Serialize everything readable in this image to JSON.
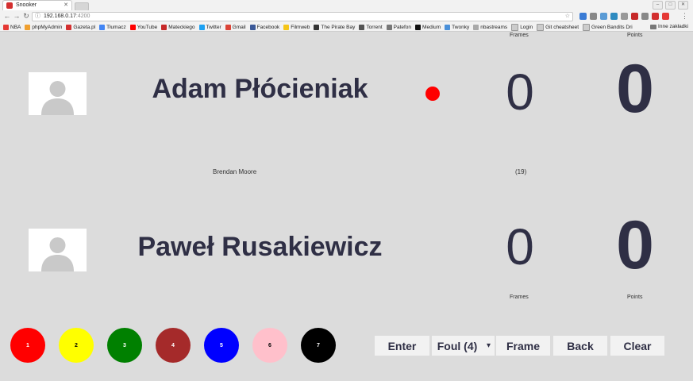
{
  "browser": {
    "tab_title": "Snooker",
    "url_host": "192.168.0.17",
    "url_port": ":4200",
    "bookmarks": [
      "NBA",
      "phpMyAdmin",
      "Gazeta.pl",
      "Tłumacz",
      "YouTube",
      "Mateckiego",
      "Twitter",
      "Gmail",
      "Facebook",
      "Filmweb",
      "The Pirate Bay",
      "Torrent",
      "Patefon",
      "Medium",
      "Twonky",
      "nbastreams",
      "Login",
      "Git cheatsheet",
      "Green Bandits Dri"
    ],
    "other_bookmarks": "Inne zakładki"
  },
  "labels": {
    "frames": "Frames",
    "points": "Points"
  },
  "player1": {
    "name": "Adam Płócieniak",
    "frames": "0",
    "points": "0",
    "at_table": true
  },
  "player2": {
    "name": "Paweł Rusakiewicz",
    "frames": "0",
    "points": "0"
  },
  "referee": "Brendan Moore",
  "break": "(19)",
  "balls": [
    {
      "label": "1",
      "color": "#ff0000",
      "text_color": "#ffffff"
    },
    {
      "label": "2",
      "color": "#ffff00",
      "text_color": "#000000"
    },
    {
      "label": "3",
      "color": "#008000",
      "text_color": "#ffffff"
    },
    {
      "label": "4",
      "color": "#a52a2a",
      "text_color": "#ffffff"
    },
    {
      "label": "5",
      "color": "#0000ff",
      "text_color": "#ffffff"
    },
    {
      "label": "6",
      "color": "#ffc0cb",
      "text_color": "#000000"
    },
    {
      "label": "7",
      "color": "#000000",
      "text_color": "#ffffff"
    }
  ],
  "actions": {
    "enter": "Enter",
    "foul": "Foul (4)",
    "frame": "Frame",
    "back": "Back",
    "clear": "Clear"
  }
}
